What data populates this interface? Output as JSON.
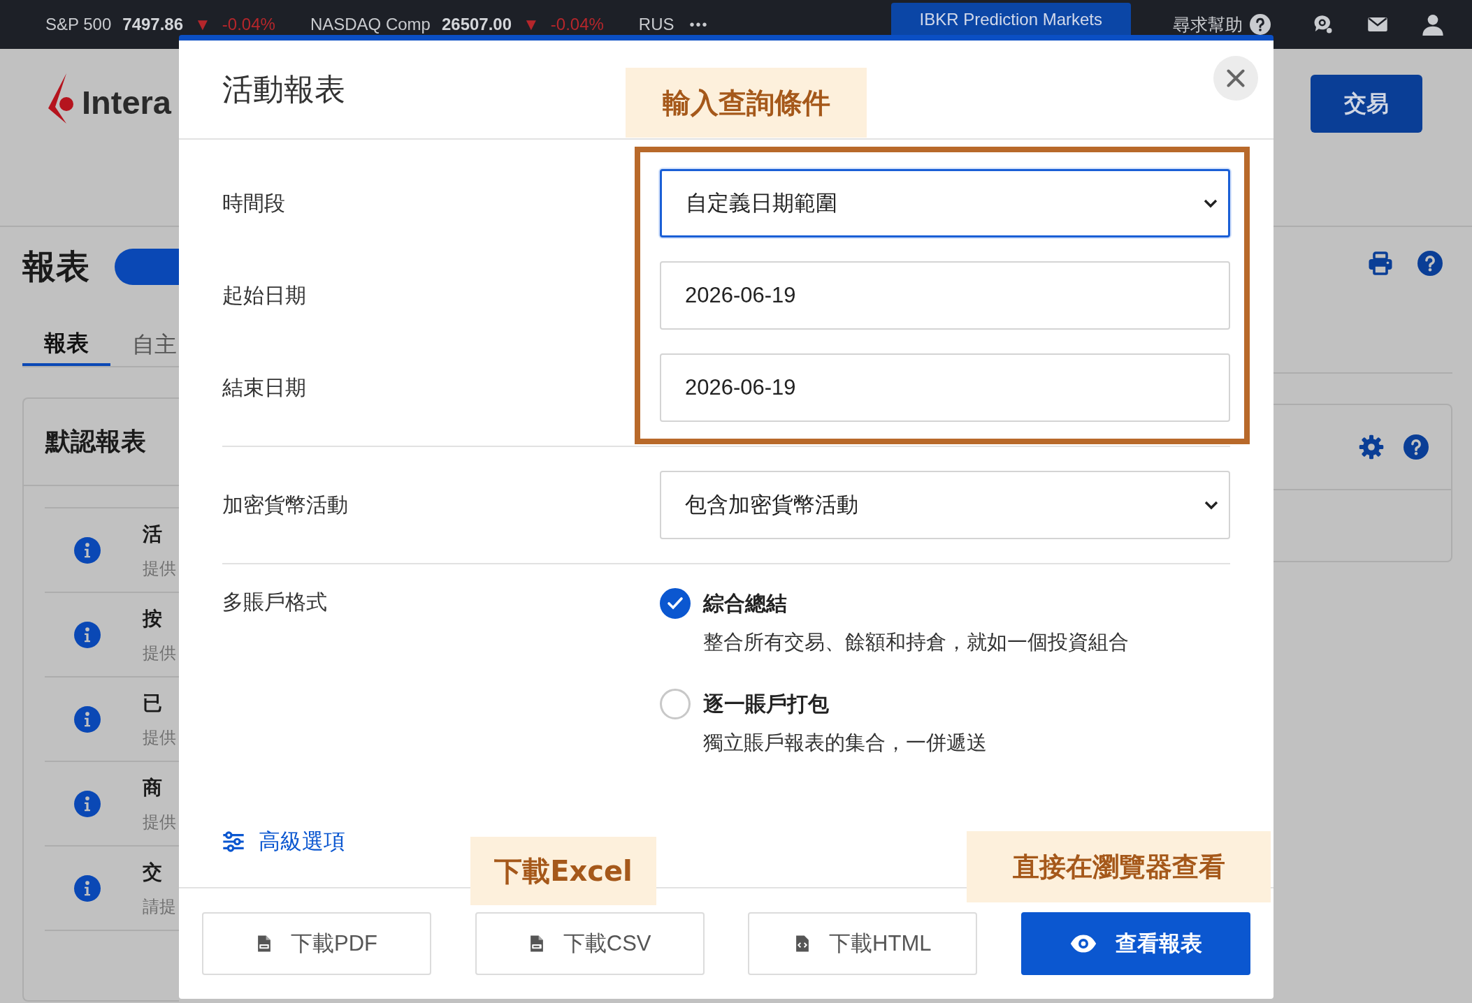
{
  "top_bar": {
    "tickers": [
      {
        "name": "S&P 500",
        "value": "7497.86",
        "arrow": "▼",
        "change": "-0.04%"
      },
      {
        "name": "NASDAQ Comp",
        "value": "26507.00",
        "arrow": "▼",
        "change": "-0.04%"
      },
      {
        "name": "RUS"
      }
    ],
    "more": "•••",
    "tab": "IBKR Prediction Markets",
    "help": "尋求幫助"
  },
  "page": {
    "logo": "Intera",
    "trade_button": "交易",
    "heading": "報表",
    "tabs": [
      {
        "label": "報表",
        "selected": true
      },
      {
        "label": "自主",
        "selected": false
      }
    ],
    "card_title": "默認報表",
    "reports": [
      {
        "title": "活",
        "description": "提供"
      },
      {
        "title": "按",
        "description": "提供"
      },
      {
        "title": "已",
        "description": "提供"
      },
      {
        "title": "商",
        "description": "提供"
      },
      {
        "title": "交",
        "description": "請提"
      }
    ]
  },
  "dialog": {
    "title": "活動報表",
    "fields": [
      {
        "kind": "select",
        "label": "時間段",
        "value": "自定義日期範圍",
        "focused": true
      },
      {
        "kind": "input",
        "label": "起始日期",
        "value": "2026-06-19",
        "focused": false
      },
      {
        "kind": "input",
        "label": "結束日期",
        "value": "2026-06-19",
        "focused": false
      },
      {
        "kind": "select",
        "label": "加密貨幣活動",
        "value": "包含加密貨幣活動",
        "focused": false
      }
    ],
    "multi_account": {
      "label": "多賬戶格式",
      "options": [
        {
          "title": "綜合總結",
          "description": "整合所有交易、餘額和持倉，就如一個投資組合",
          "selected": true
        },
        {
          "title": "逐一賬戶打包",
          "description": "獨立賬戶報表的集合，一併遞送",
          "selected": false
        }
      ]
    },
    "advanced": "高級選項",
    "buttons": [
      {
        "kind": "pdf",
        "label": "下載PDF"
      },
      {
        "kind": "csv",
        "label": "下載CSV"
      },
      {
        "kind": "html",
        "label": "下載HTML"
      },
      {
        "kind": "view",
        "label": "查看報表"
      }
    ]
  },
  "annotations": [
    {
      "kind": "criteria",
      "text": "輸入查詢條件"
    },
    {
      "kind": "excel",
      "text": "下載Excel"
    },
    {
      "kind": "browser",
      "text": "直接在瀏覽器查看"
    }
  ]
}
